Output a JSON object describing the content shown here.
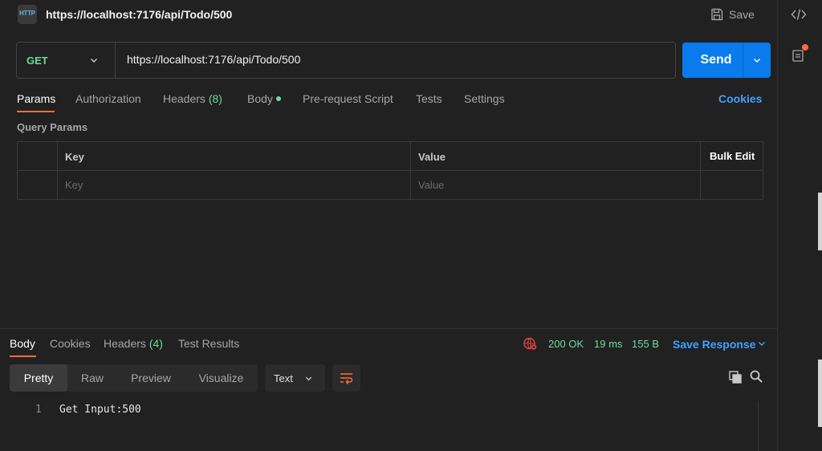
{
  "request": {
    "title": "https://localhost:7176/api/Todo/500",
    "icon_text": "HTTP",
    "save_label": "Save",
    "method": "GET",
    "url": "https://localhost:7176/api/Todo/500",
    "send_label": "Send"
  },
  "request_tabs": {
    "params": "Params",
    "authorization": "Authorization",
    "headers": "Headers",
    "headers_count": "(8)",
    "body": "Body",
    "pre_request": "Pre-request Script",
    "tests": "Tests",
    "settings": "Settings",
    "cookies": "Cookies"
  },
  "query_params": {
    "title": "Query Params",
    "key_header": "Key",
    "value_header": "Value",
    "bulk_edit": "Bulk Edit",
    "key_placeholder": "Key",
    "value_placeholder": "Value"
  },
  "response_tabs": {
    "body": "Body",
    "cookies": "Cookies",
    "headers": "Headers",
    "headers_count": "(4)",
    "test_results": "Test Results"
  },
  "response_status": {
    "status": "200 OK",
    "time": "19 ms",
    "size": "155 B",
    "save_response": "Save Response"
  },
  "view_modes": {
    "pretty": "Pretty",
    "raw": "Raw",
    "preview": "Preview",
    "visualize": "Visualize",
    "format": "Text"
  },
  "response_body": {
    "line_number": "1",
    "line": "Get Input:500"
  },
  "colors": {
    "accent_orange": "#ff6c37",
    "send_blue": "#097bed",
    "link_blue": "#3fa2ff",
    "success_green": "#6bdd9a"
  }
}
